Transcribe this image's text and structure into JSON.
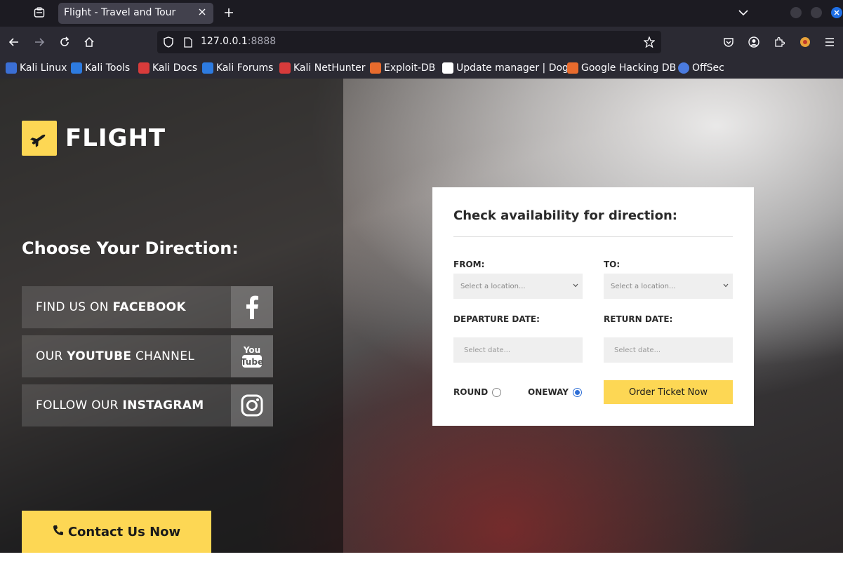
{
  "browser": {
    "tab_title": "Flight - Travel and Tour",
    "url_host": "127.0.0.1",
    "url_port": ":8888",
    "bookmarks": [
      {
        "label": "Kali Linux",
        "color": "#3b6fd6"
      },
      {
        "label": "Kali Tools",
        "color": "#2d7be0"
      },
      {
        "label": "Kali Docs",
        "color": "#d83b3b"
      },
      {
        "label": "Kali Forums",
        "color": "#2d7be0"
      },
      {
        "label": "Kali NetHunter",
        "color": "#d83b3b"
      },
      {
        "label": "Exploit-DB",
        "color": "#e86b2d"
      },
      {
        "label": "Update manager | Dog",
        "color": "#ffffff"
      },
      {
        "label": "Google Hacking DB",
        "color": "#e86b2d"
      },
      {
        "label": "OffSec",
        "color": "#4a7be0"
      }
    ]
  },
  "site": {
    "logo_text": "FLIGHT",
    "choose_title": "Choose Your Direction:",
    "social": [
      {
        "prefix": "FIND US ON ",
        "bold": "FACEBOOK",
        "suffix": "",
        "icon": "facebook-icon"
      },
      {
        "prefix": "OUR ",
        "bold": "YOUTUBE",
        "suffix": " CHANNEL",
        "icon": "youtube-icon"
      },
      {
        "prefix": "FOLLOW OUR ",
        "bold": "INSTAGRAM",
        "suffix": "",
        "icon": "instagram-icon"
      }
    ],
    "contact_label": "Contact Us Now",
    "accent_color": "#fdd754"
  },
  "form": {
    "title": "Check availability for direction:",
    "from_label": "FROM:",
    "to_label": "TO:",
    "from_placeholder": "Select a location...",
    "to_placeholder": "Select a location...",
    "departure_label": "DEPARTURE DATE:",
    "return_label": "RETURN DATE:",
    "departure_placeholder": "Select date...",
    "return_placeholder": "Select date...",
    "round_label": "ROUND",
    "oneway_label": "ONEWAY",
    "selected_trip": "ONEWAY",
    "order_button": "Order Ticket Now"
  }
}
